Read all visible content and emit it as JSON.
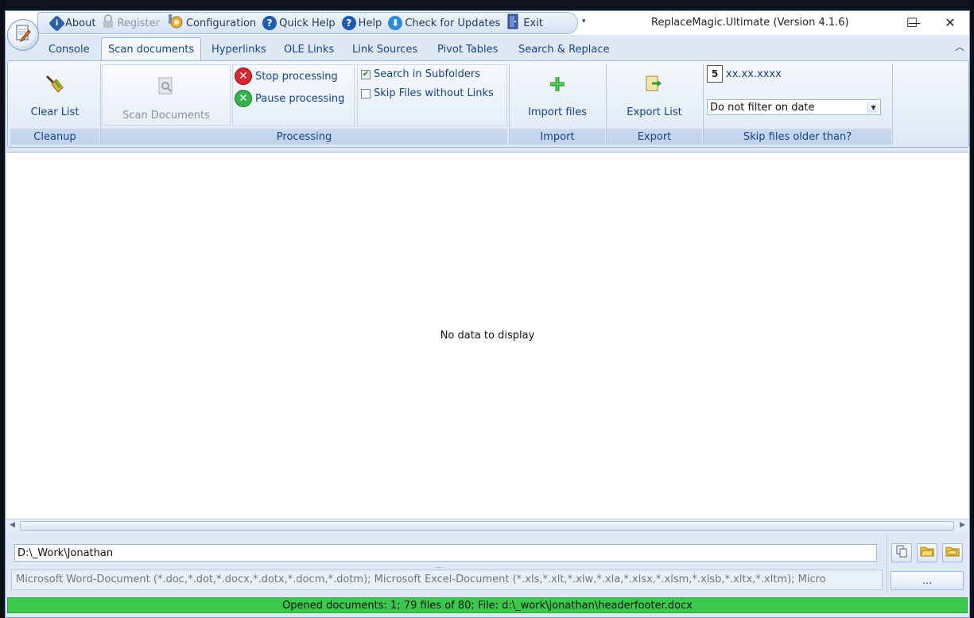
{
  "window": {
    "title": "ReplaceMagic.Ultimate (Version 4.1.6)",
    "minimize": "—",
    "maximize": "☐",
    "close": "✕"
  },
  "quick_access": {
    "about": "About",
    "register": "Register",
    "configuration": "Configuration",
    "quick_help": "Quick Help",
    "help": "Help",
    "check_updates": "Check for Updates",
    "exit": "Exit",
    "dropdown": "▾"
  },
  "tabs": [
    "Console",
    "Scan documents",
    "Hyperlinks",
    "OLE Links",
    "Link Sources",
    "Pivot Tables",
    "Search & Replace"
  ],
  "active_tab": "Scan documents",
  "ribbon": {
    "cleanup": {
      "button": "Clear List",
      "group": "Cleanup"
    },
    "processing": {
      "scan": "Scan Documents",
      "stop": "Stop processing",
      "pause": "Pause processing",
      "search_subfolders": "Search in Subfolders",
      "search_subfolders_checked": true,
      "skip_files": "Skip Files without Links",
      "skip_files_checked": false,
      "group": "Processing"
    },
    "import": {
      "button": "Import files",
      "group": "Import"
    },
    "export": {
      "button": "Export List",
      "group": "Export"
    },
    "skip_old": {
      "date_placeholder": "xx.xx.xxxx",
      "calendar_day": "5",
      "filter_value": "Do not filter on date",
      "group": "Skip files older than?"
    }
  },
  "grid": {
    "empty_text": "No data to display"
  },
  "bottom": {
    "path": "D:\\_Work\\Jonathan",
    "filter": "Microsoft Word-Document (*.doc,*.dot,*.docx,*.dotx,*.docm,*.dotm); Microsoft Excel-Document (*.xls,*.xlt,*.xlw,*.xla,*.xlsx,*.xlsm,*.xlsb,*.xltx,*.xltm); Micro",
    "more_button": "..."
  },
  "status": "Opened documents: 1; 79 files of 80; File: d:\\_work\\jonathan\\headerfooter.docx",
  "colors": {
    "accent": "#15428b",
    "ribbon_bg": "#dfe9f5",
    "status_green": "#3ac94c",
    "stop_red": "#d9262c",
    "pause_green": "#35b449"
  }
}
